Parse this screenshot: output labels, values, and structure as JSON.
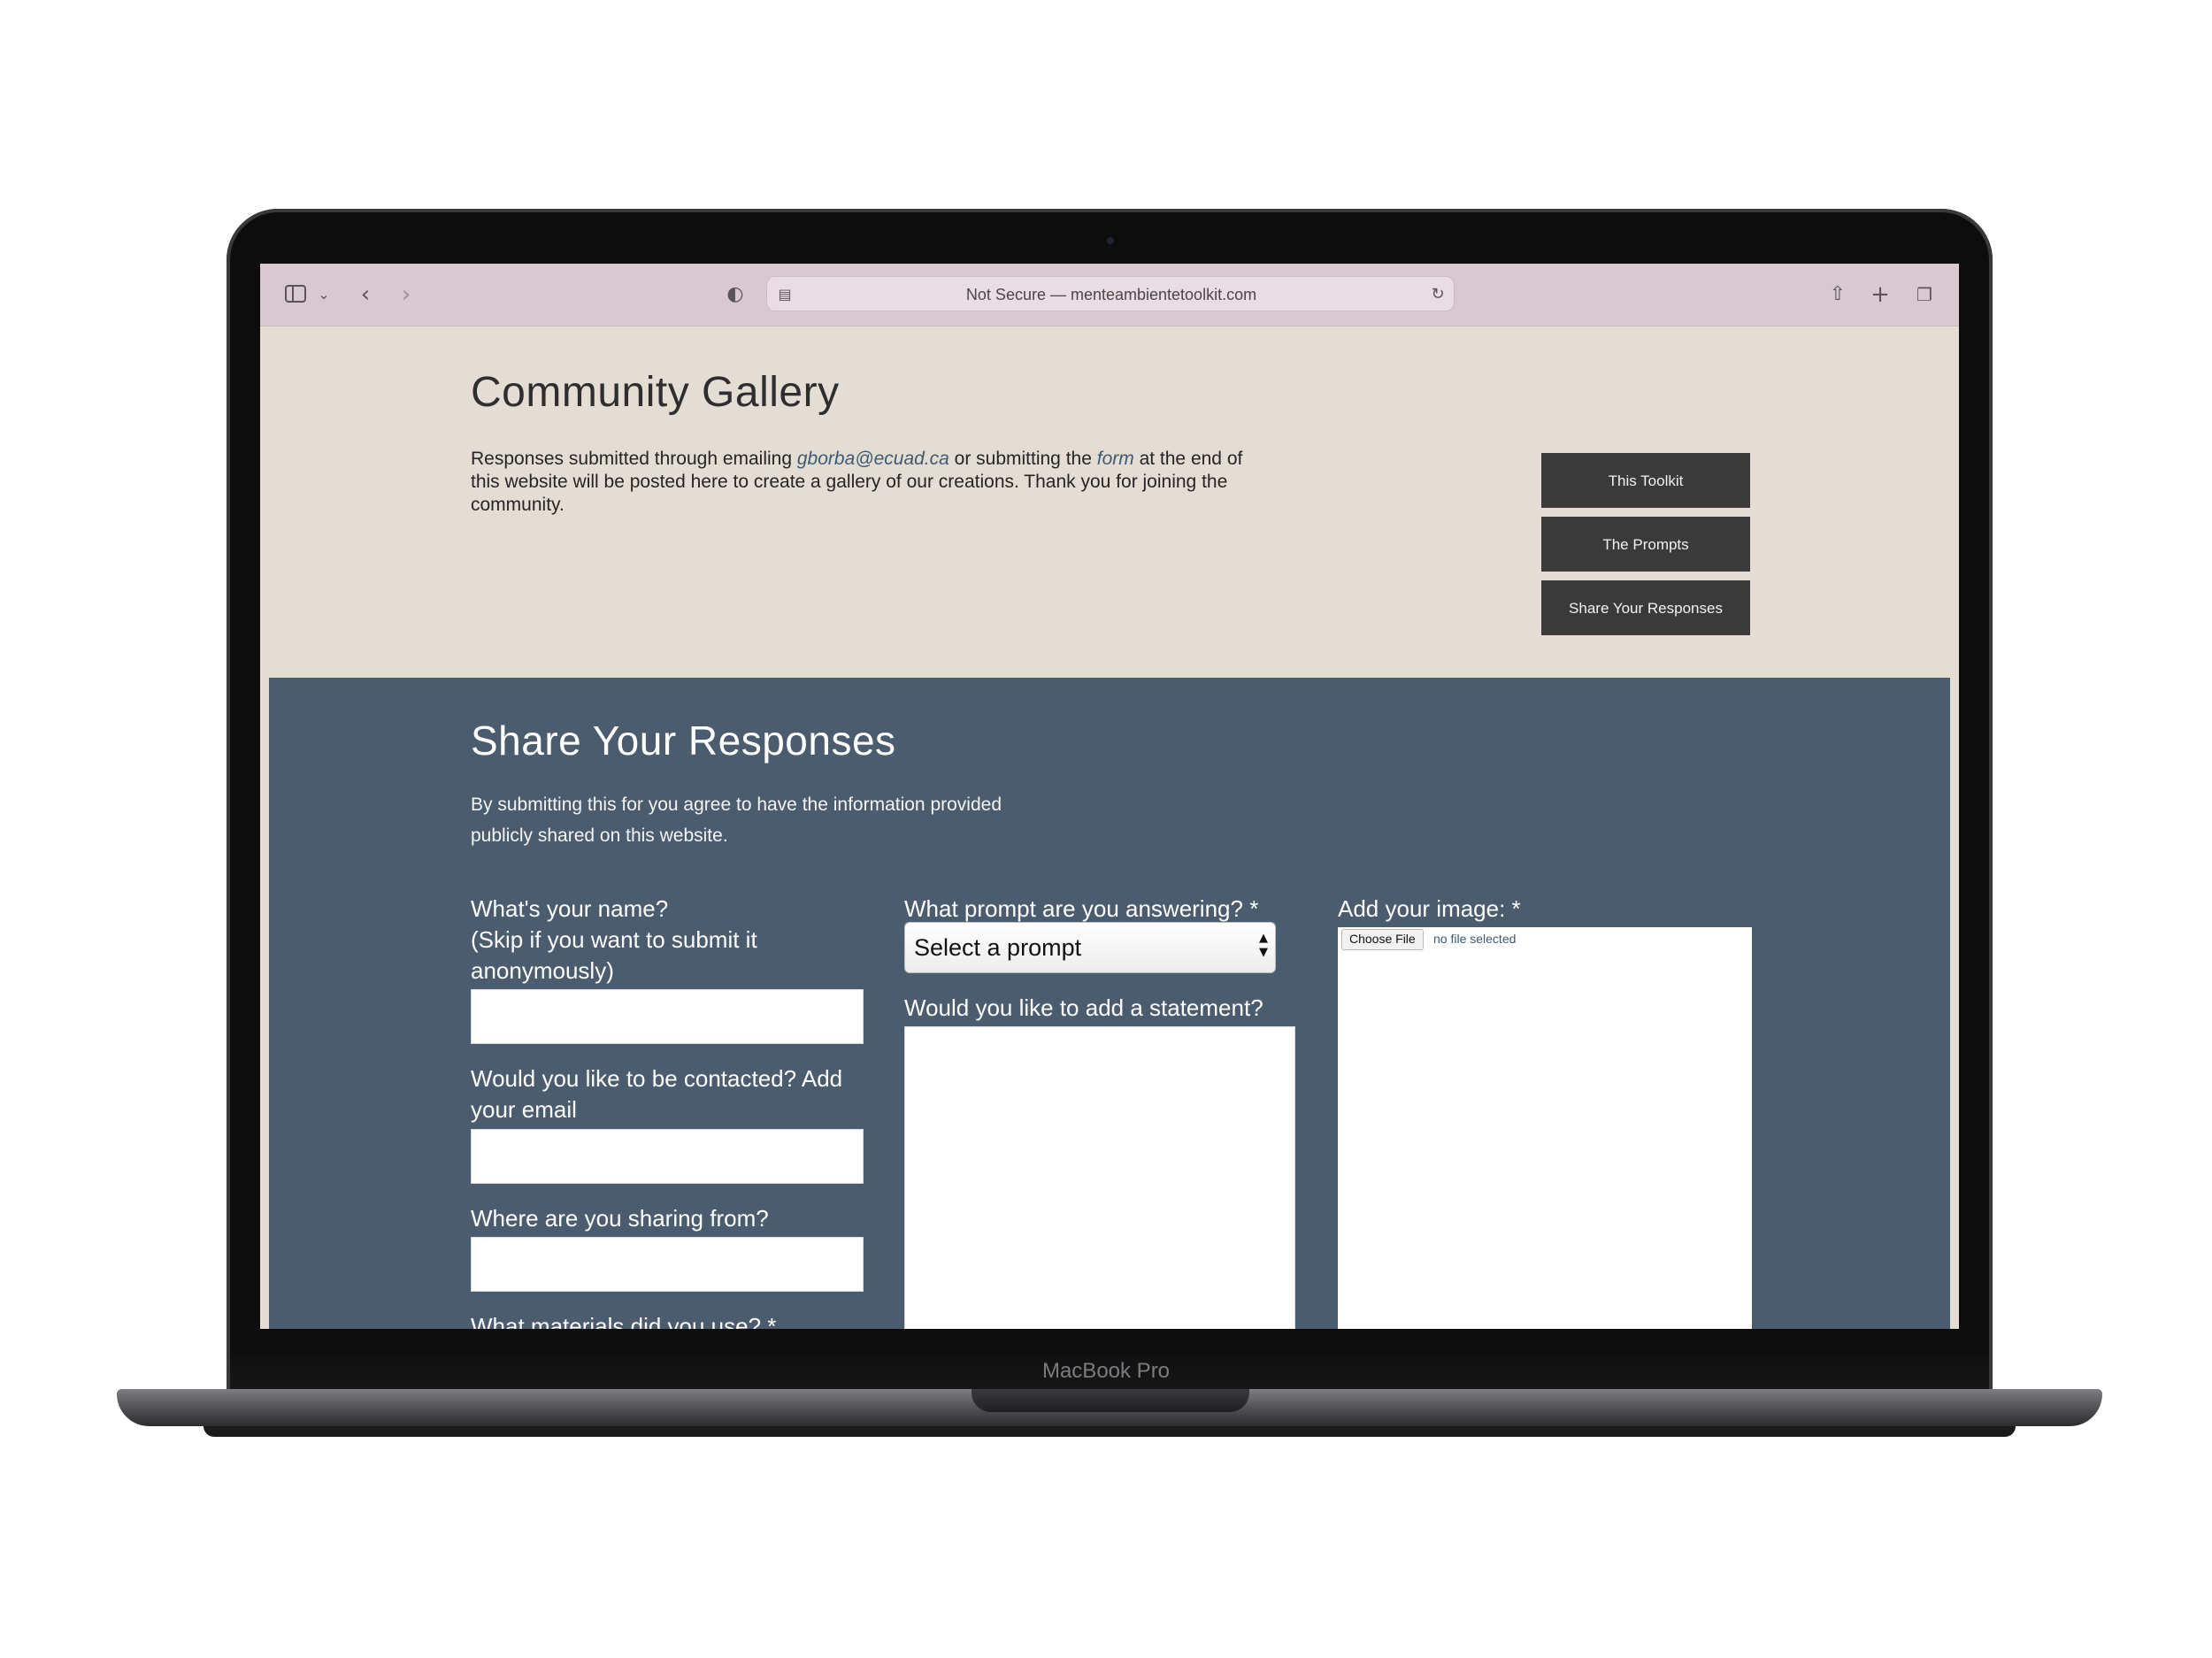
{
  "device": {
    "model_label": "MacBook Pro"
  },
  "browser": {
    "address": "Not Secure — menteambientetoolkit.com"
  },
  "hero": {
    "title": "Community Gallery",
    "desc_part1": "Responses submitted through emailing ",
    "email_link": "gborba@ecuad.ca",
    "desc_part2": " or submitting the ",
    "form_link": "form",
    "desc_part3": " at the end of this website will be posted here to create a gallery of our creations. Thank you for joining the community."
  },
  "nav": {
    "toolkit": "This Toolkit",
    "prompts": "The Prompts",
    "share": "Share Your Responses"
  },
  "form": {
    "title": "Share Your Responses",
    "desc": "By submitting this for you agree to have the information provided publicly shared on this website.",
    "name_label_1": "What's your name?",
    "name_label_2": "(Skip if you want to submit it anonymously)",
    "email_label": "Would you like to be contacted? Add your email",
    "location_label": "Where are you sharing from?",
    "materials_label": "What materials did you use? *",
    "prompt_label": "What prompt are you answering? *",
    "prompt_selected": "Select a prompt",
    "statement_label": "Would you like to add a statement?",
    "image_label": "Add your image: *",
    "choose_file": "Choose File",
    "file_status": "no file selected"
  },
  "colors": {
    "browser_bar": "#dac8d1",
    "page_background": "#e4ddd4",
    "form_background": "#4a5c6e",
    "nav_button": "#3a3a3a",
    "link": "#3e5a73"
  },
  "icons": [
    "sidebar-icon",
    "chevron-down-icon",
    "back-arrow-icon",
    "forward-arrow-icon",
    "shield-icon",
    "reader-icon",
    "reload-icon",
    "share-icon",
    "plus-icon",
    "tabs-icon"
  ]
}
